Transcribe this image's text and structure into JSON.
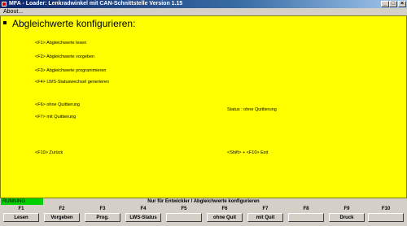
{
  "titlebar": {
    "title": "MFA - Loader: Lenkradwinkel mit CAN-Schnittstelle Version 1.15",
    "min": "_",
    "max": "□",
    "close": "×"
  },
  "menu": {
    "about": "About..."
  },
  "main": {
    "heading": "Abgleichwerte konfigurieren:",
    "items": [
      "<F1> Abgleichwerte lesen",
      "<F2> Abgleichwerte vorgeben",
      "<F3> Abgleichwerte programmieren",
      "<F4> LWS-Statuswechsel generieren",
      "<F6> ohne Quittierung",
      "<F7> mit Quittierung",
      "<F10> Zurück"
    ],
    "status_label": "Status : ohne Quittierung",
    "exit_hint": "<Shift> + <F10> Exit"
  },
  "statusbar": {
    "running": "RUNNING",
    "text": "Nur für Entwickler / Abgleichwerte konfigurieren"
  },
  "fkeys": [
    {
      "num": "F1",
      "label": "Lesen"
    },
    {
      "num": "F2",
      "label": "Vorgeben"
    },
    {
      "num": "F3",
      "label": "Prog."
    },
    {
      "num": "F4",
      "label": "LWS-Status"
    },
    {
      "num": "F5",
      "label": ""
    },
    {
      "num": "F6",
      "label": "ohne Quit"
    },
    {
      "num": "F7",
      "label": "mit Quit"
    },
    {
      "num": "F8",
      "label": ""
    },
    {
      "num": "F9",
      "label": "Druck"
    },
    {
      "num": "F10",
      "label": ""
    }
  ]
}
